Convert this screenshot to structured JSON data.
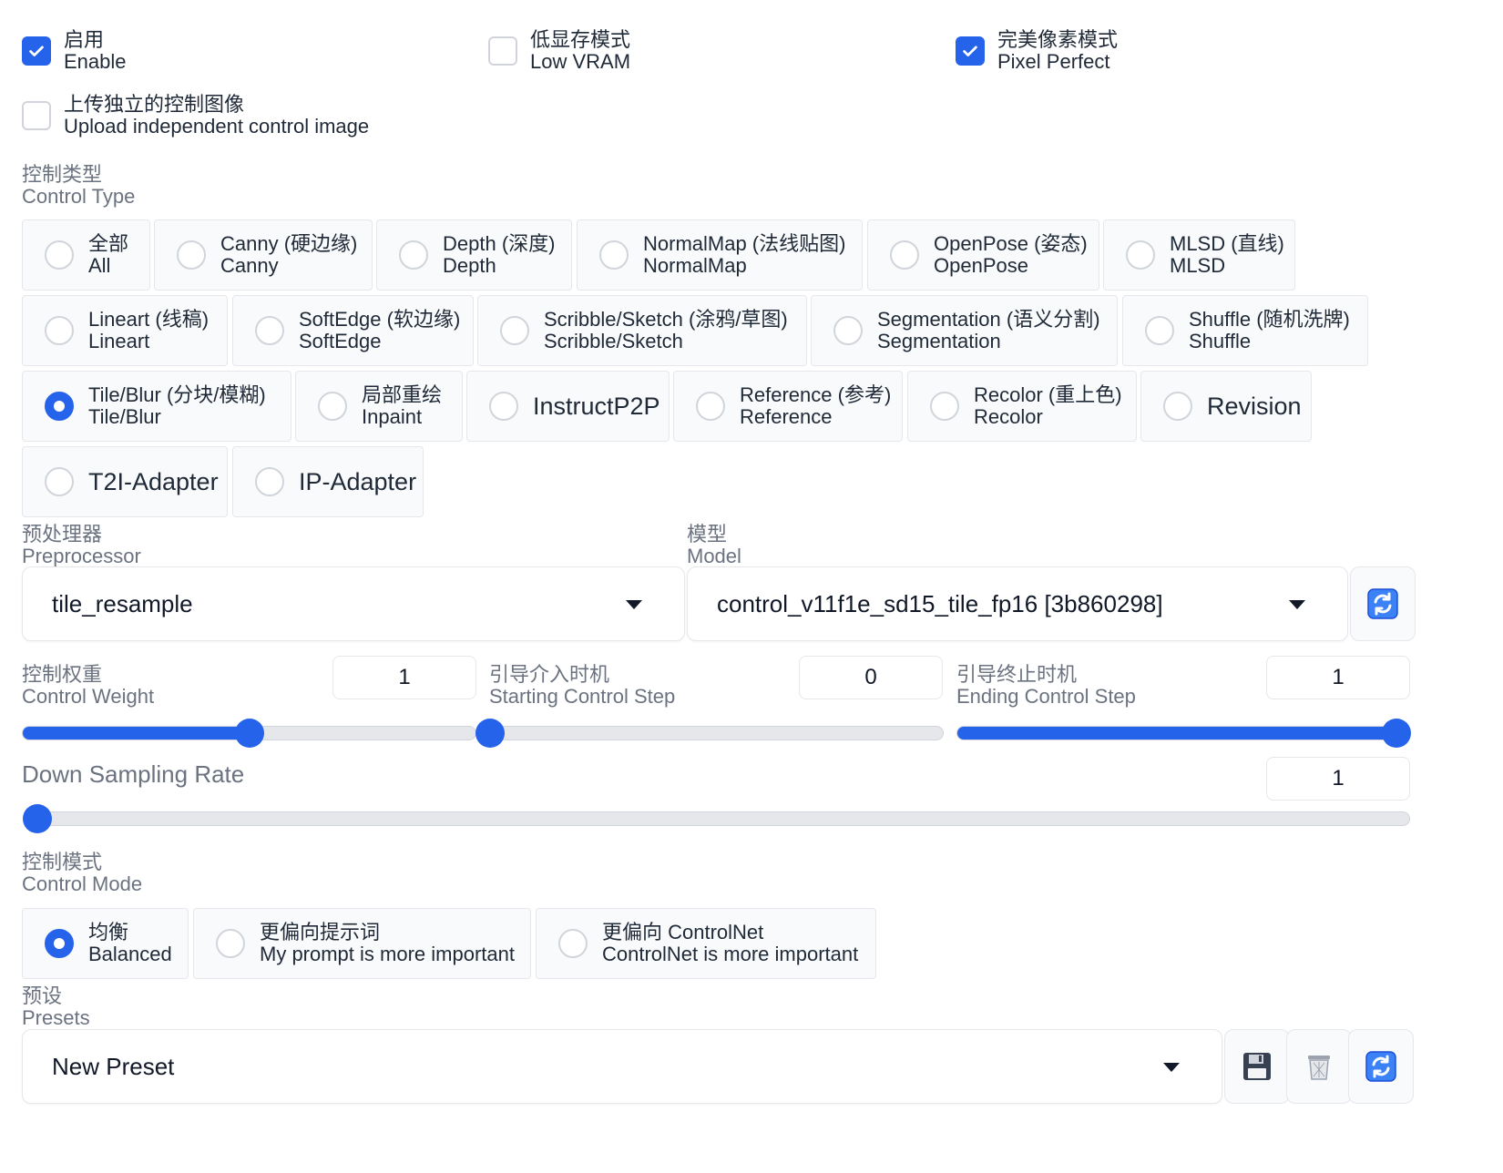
{
  "checkboxes": {
    "enable": {
      "zh": "启用",
      "en": "Enable",
      "checked": true
    },
    "low_vram": {
      "zh": "低显存模式",
      "en": "Low VRAM",
      "checked": false
    },
    "pixel_perfect": {
      "zh": "完美像素模式",
      "en": "Pixel Perfect",
      "checked": true
    },
    "upload_independent": {
      "zh": "上传独立的控制图像",
      "en": "Upload independent control image",
      "checked": false
    }
  },
  "control_type": {
    "label_zh": "控制类型",
    "label_en": "Control Type",
    "selected": "Tile/Blur",
    "options": [
      {
        "zh": "全部",
        "en": "All"
      },
      {
        "zh": "Canny (硬边缘)",
        "en": "Canny"
      },
      {
        "zh": "Depth (深度)",
        "en": "Depth"
      },
      {
        "zh": "NormalMap (法线贴图)",
        "en": "NormalMap"
      },
      {
        "zh": "OpenPose (姿态)",
        "en": "OpenPose"
      },
      {
        "zh": "MLSD (直线)",
        "en": "MLSD"
      },
      {
        "zh": "Lineart (线稿)",
        "en": "Lineart"
      },
      {
        "zh": "SoftEdge (软边缘)",
        "en": "SoftEdge"
      },
      {
        "zh": "Scribble/Sketch (涂鸦/草图)",
        "en": "Scribble/Sketch"
      },
      {
        "zh": "Segmentation (语义分割)",
        "en": "Segmentation"
      },
      {
        "zh": "Shuffle (随机洗牌)",
        "en": "Shuffle"
      },
      {
        "zh": "Tile/Blur (分块/模糊)",
        "en": "Tile/Blur"
      },
      {
        "zh": "局部重绘",
        "en": "Inpaint"
      },
      {
        "single": "InstructP2P"
      },
      {
        "zh": "Reference (参考)",
        "en": "Reference"
      },
      {
        "zh": "Recolor (重上色)",
        "en": "Recolor"
      },
      {
        "single": "Revision"
      },
      {
        "single": "T2I-Adapter"
      },
      {
        "single": "IP-Adapter"
      }
    ]
  },
  "preprocessor": {
    "label_zh": "预处理器",
    "label_en": "Preprocessor",
    "value": "tile_resample"
  },
  "model": {
    "label_zh": "模型",
    "label_en": "Model",
    "value": "control_v11f1e_sd15_tile_fp16 [3b860298]"
  },
  "sliders": {
    "control_weight": {
      "label_zh": "控制权重",
      "label_en": "Control Weight",
      "value": "1",
      "fraction": 0.5
    },
    "starting_step": {
      "label_zh": "引导介入时机",
      "label_en": "Starting Control Step",
      "value": "0",
      "fraction": 0.0
    },
    "ending_step": {
      "label_zh": "引导终止时机",
      "label_en": "Ending Control Step",
      "value": "1",
      "fraction": 1.0
    },
    "down_sampling": {
      "label": "Down Sampling Rate",
      "value": "1",
      "fraction": 0.0
    }
  },
  "control_mode": {
    "label_zh": "控制模式",
    "label_en": "Control Mode",
    "selected": "Balanced",
    "options": [
      {
        "zh": "均衡",
        "en": "Balanced"
      },
      {
        "zh": "更偏向提示词",
        "en": "My prompt is more important"
      },
      {
        "zh": "更偏向 ControlNet",
        "en": "ControlNet is more important"
      }
    ]
  },
  "presets": {
    "label_zh": "预设",
    "label_en": "Presets",
    "value": "New Preset"
  },
  "icons": [
    "check-icon",
    "refresh-icon",
    "save-icon",
    "trash-icon",
    "caret-down-icon"
  ],
  "colors": {
    "accent": "#2563eb",
    "border": "#e5e7eb",
    "option_bg": "#f9fafb",
    "muted_text": "#6b7280"
  }
}
